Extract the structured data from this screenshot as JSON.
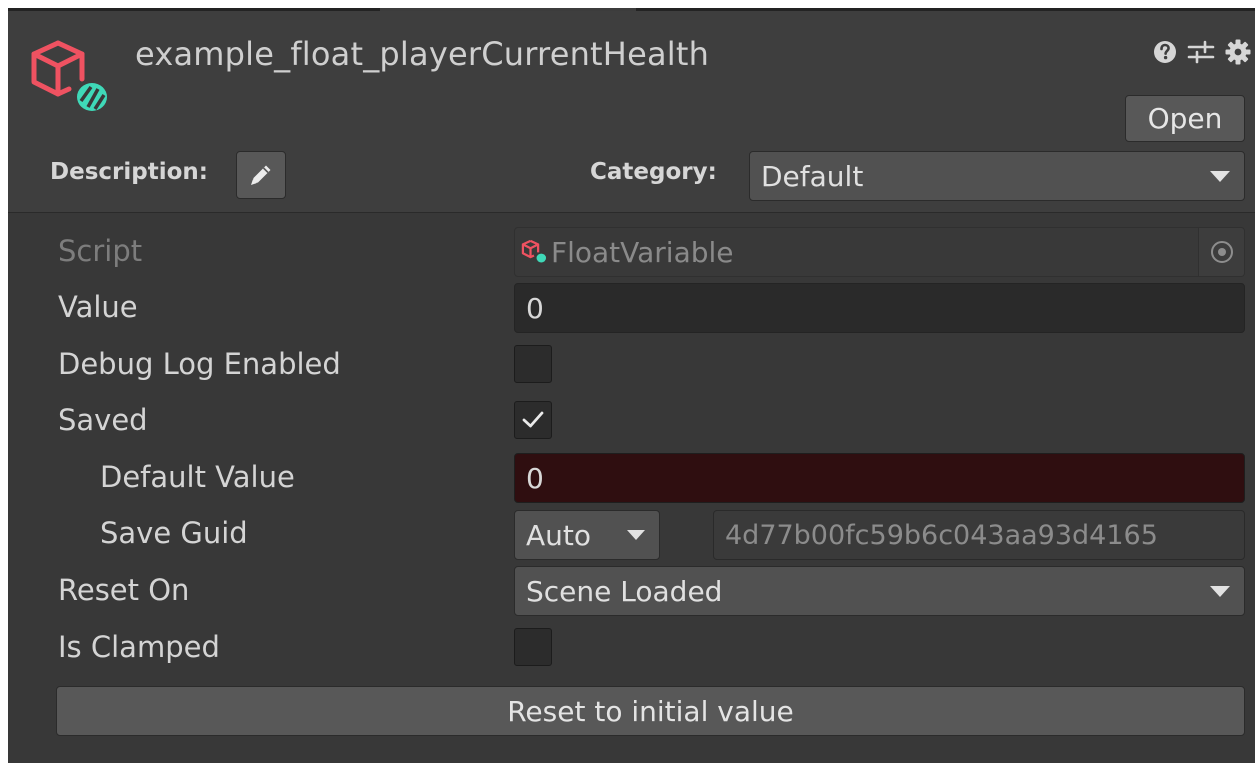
{
  "header": {
    "asset_title": "example_float_playerCurrentHealth",
    "open_label": "Open",
    "description_label": "Description:",
    "category_label": "Category:",
    "category_value": "Default",
    "icons": [
      "help-icon",
      "sliders-icon",
      "gear-icon",
      "edit-icon"
    ]
  },
  "fields": {
    "script_label": "Script",
    "script_value": "FloatVariable",
    "value_label": "Value",
    "value_value": "0",
    "debug_label": "Debug Log Enabled",
    "debug_checked": false,
    "saved_label": "Saved",
    "saved_checked": true,
    "default_value_label": "Default Value",
    "default_value_value": "0",
    "save_guid_label": "Save Guid",
    "save_guid_mode": "Auto",
    "save_guid_value": "4d77b00fc59b6c043aa93d4165",
    "reset_on_label": "Reset On",
    "reset_on_value": "Scene Loaded",
    "is_clamped_label": "Is Clamped",
    "is_clamped_checked": false
  },
  "actions": {
    "reset_label": "Reset to initial value"
  },
  "colors": {
    "panel_bg": "#383838",
    "header_bg": "#3e3e3e",
    "logo_red": "#ef5261",
    "logo_teal": "#3fd9b8",
    "default_value_bg": "#2f0e10"
  }
}
